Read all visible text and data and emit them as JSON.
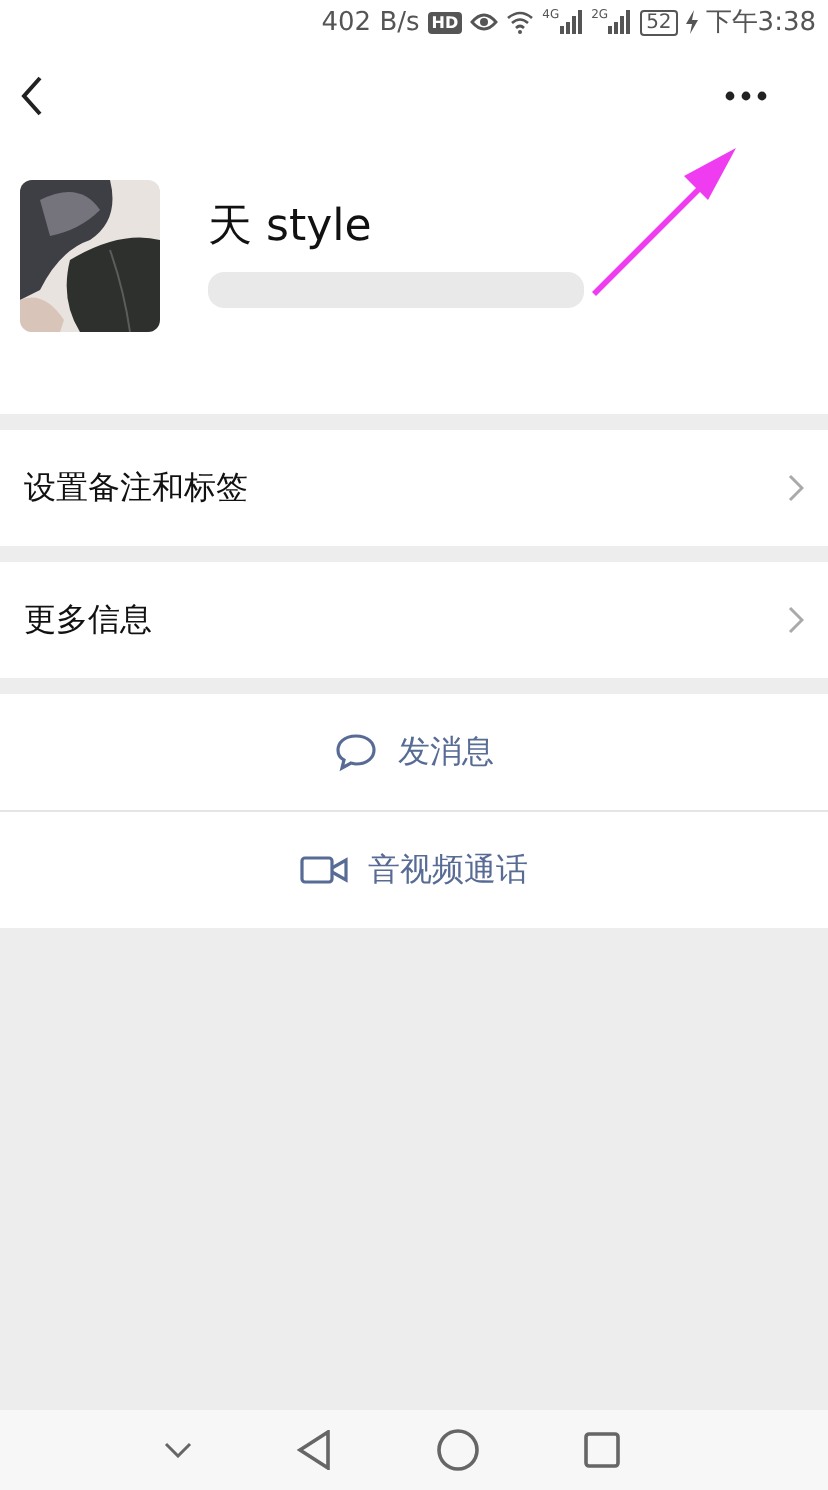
{
  "status_bar": {
    "speed": "402 B/s",
    "hd": "HD",
    "network_1": "4G",
    "network_2": "2G",
    "battery": "52",
    "time": "下午3:38"
  },
  "profile": {
    "name": "天 style"
  },
  "menu_items": [
    {
      "label": "设置备注和标签"
    },
    {
      "label": "更多信息"
    }
  ],
  "actions": [
    {
      "kind": "message",
      "label": "发消息"
    },
    {
      "kind": "video",
      "label": "音视频通话"
    }
  ]
}
